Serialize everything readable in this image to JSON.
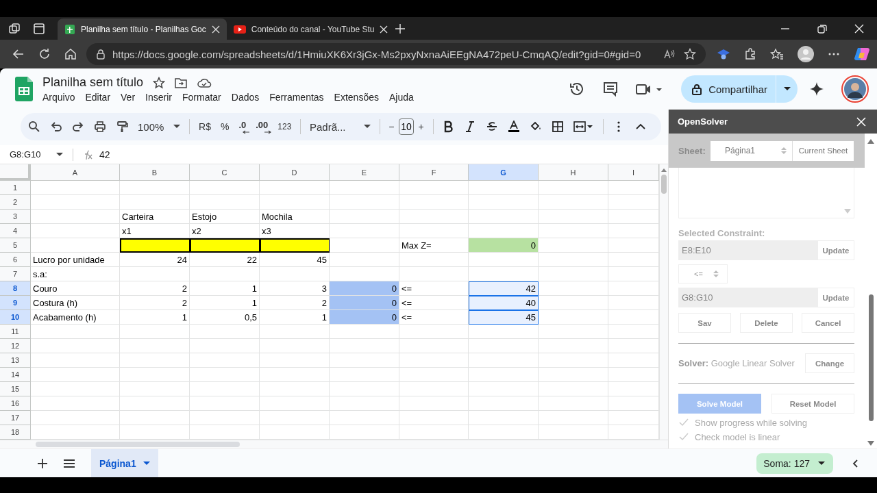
{
  "browser": {
    "tabs": [
      {
        "title": "Planilha sem título - Planilhas Goc",
        "kind": "sheets",
        "selected": true
      },
      {
        "title": "Conteúdo do canal - YouTube Stu",
        "kind": "youtube",
        "selected": false
      }
    ],
    "address": "https://docs.google.com/spreadsheets/d/1HmiuXK6Xr3jGx-Ms2pxyNxnaAiEEgNA472peU-CmqAQ/edit?gid=0#gid=0"
  },
  "document": {
    "title": "Planilha sem título",
    "menu": [
      "Arquivo",
      "Editar",
      "Ver",
      "Inserir",
      "Formatar",
      "Dados",
      "Ferramentas",
      "Extensões",
      "Ajuda"
    ],
    "share_label": "Compartilhar"
  },
  "toolbar": {
    "zoom": "100%",
    "currency": "R$",
    "percent": "%",
    "decrease_decimals": ".0",
    "increase_decimals": ".00",
    "number_format": "123",
    "font": "Padrã...",
    "font_size": "10",
    "minus": "−",
    "plus": "+"
  },
  "formula_bar": {
    "name_box": "G8:G10",
    "value": "42"
  },
  "grid": {
    "columns": [
      {
        "label": "A",
        "selected": false
      },
      {
        "label": "B",
        "selected": false
      },
      {
        "label": "C",
        "selected": false
      },
      {
        "label": "D",
        "selected": false
      },
      {
        "label": "E",
        "selected": false
      },
      {
        "label": "F",
        "selected": false
      },
      {
        "label": "G",
        "selected": true
      },
      {
        "label": "H",
        "selected": false
      },
      {
        "label": "I",
        "selected": false
      }
    ],
    "rows": [
      {
        "header": "1",
        "selected": false,
        "cells": []
      },
      {
        "header": "2",
        "selected": false,
        "cells": []
      },
      {
        "header": "3",
        "selected": false,
        "cells": {
          "B": {
            "text": "Carteira",
            "kind": "text"
          },
          "C": {
            "text": "Estojo",
            "kind": "text"
          },
          "D": {
            "text": "Mochila",
            "kind": "text"
          }
        }
      },
      {
        "header": "4",
        "selected": false,
        "cells": {
          "B": {
            "text": "x1",
            "kind": "text"
          },
          "C": {
            "text": "x2",
            "kind": "text"
          },
          "D": {
            "text": "x3",
            "kind": "text"
          }
        }
      },
      {
        "header": "5",
        "selected": false,
        "cells": {
          "B": {
            "color": "#ffff00",
            "bordered": true
          },
          "C": {
            "color": "#ffff00",
            "bordered": true
          },
          "D": {
            "color": "#ffff00",
            "bordered": true
          },
          "F": {
            "text": "Max Z=",
            "kind": "text"
          },
          "G": {
            "text": "0",
            "kind": "number",
            "color": "#b7e1a1"
          }
        }
      },
      {
        "header": "6",
        "selected": false,
        "cells": {
          "A": {
            "text": "Lucro por unidade",
            "kind": "text"
          },
          "B": {
            "text": "24",
            "kind": "number"
          },
          "C": {
            "text": "22",
            "kind": "number"
          },
          "D": {
            "text": "45",
            "kind": "number"
          }
        }
      },
      {
        "header": "7",
        "selected": false,
        "cells": {
          "A": {
            "text": "s.a:",
            "kind": "text"
          }
        }
      },
      {
        "header": "8",
        "selected": true,
        "cells": {
          "A": {
            "text": "Couro",
            "kind": "text"
          },
          "B": {
            "text": "2",
            "kind": "number"
          },
          "C": {
            "text": "1",
            "kind": "number"
          },
          "D": {
            "text": "3",
            "kind": "number"
          },
          "E": {
            "text": "0",
            "kind": "number",
            "color": "#a4c2f4"
          },
          "F": {
            "text": "<=",
            "kind": "text"
          },
          "G": {
            "text": "42",
            "kind": "number",
            "selected": true
          }
        }
      },
      {
        "header": "9",
        "selected": true,
        "cells": {
          "A": {
            "text": "Costura (h)",
            "kind": "text"
          },
          "B": {
            "text": "2",
            "kind": "number"
          },
          "C": {
            "text": "1",
            "kind": "number"
          },
          "D": {
            "text": "2",
            "kind": "number"
          },
          "E": {
            "text": "0",
            "kind": "number",
            "color": "#a4c2f4"
          },
          "F": {
            "text": "<=",
            "kind": "text"
          },
          "G": {
            "text": "40",
            "kind": "number",
            "selected": true
          }
        }
      },
      {
        "header": "10",
        "selected": true,
        "cells": {
          "A": {
            "text": "Acabamento (h)",
            "kind": "text"
          },
          "B": {
            "text": "1",
            "kind": "number"
          },
          "C": {
            "text": "0,5",
            "kind": "number"
          },
          "D": {
            "text": "1",
            "kind": "number"
          },
          "E": {
            "text": "0",
            "kind": "number",
            "color": "#a4c2f4"
          },
          "F": {
            "text": "<=",
            "kind": "text"
          },
          "G": {
            "text": "45",
            "kind": "number",
            "selected": true
          }
        }
      },
      {
        "header": "11",
        "selected": false,
        "cells": []
      },
      {
        "header": "12",
        "selected": false,
        "cells": []
      },
      {
        "header": "13",
        "selected": false,
        "cells": []
      },
      {
        "header": "14",
        "selected": false,
        "cells": []
      },
      {
        "header": "15",
        "selected": false,
        "cells": []
      },
      {
        "header": "16",
        "selected": false,
        "cells": []
      },
      {
        "header": "17",
        "selected": false,
        "cells": []
      },
      {
        "header": "18",
        "selected": false,
        "cells": []
      }
    ]
  },
  "sheet_tabs": [
    {
      "label": "Página1",
      "selected": true
    }
  ],
  "sum_label": "Soma: 127",
  "solver_panel": {
    "title": "OpenSolver",
    "sheet_label": "Sheet:",
    "sheet_value": "Página1",
    "current_sheet_button": "Current Sheet",
    "constraint_label": "Selected Constraint:",
    "left_field": "E8:E10",
    "left_update_button": "Update",
    "operator": "<=",
    "right_field": "G8:G10",
    "right_update_button": "Update",
    "actions": [
      {
        "label": "Sav"
      },
      {
        "label": "Delete"
      },
      {
        "label": "Cancel"
      }
    ],
    "solver_text": "**Solver:** Google Linear Solver",
    "change_button": "Change",
    "solve_button": "Solve Model",
    "reset_button": "Reset Model",
    "options": [
      {
        "label": "Show progress while solving",
        "checked": true
      },
      {
        "label": "Check model is linear",
        "checked": true
      }
    ]
  }
}
